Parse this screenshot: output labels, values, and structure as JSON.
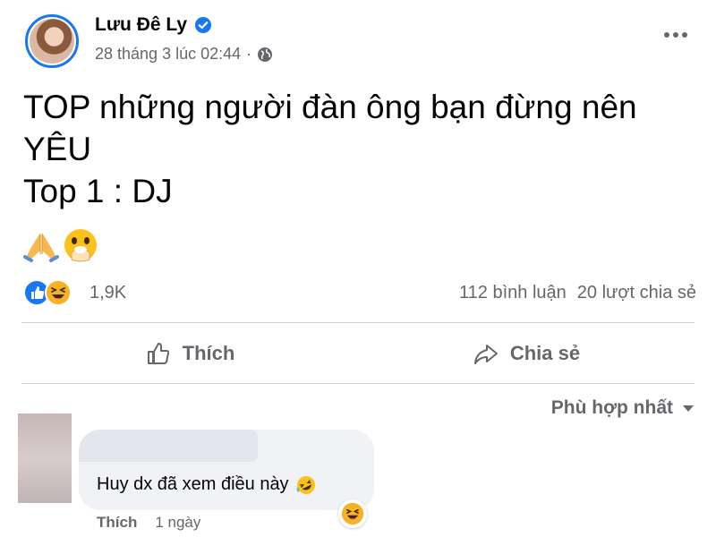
{
  "post": {
    "author": "Lưu Đê Ly",
    "timestamp": "28 tháng 3 lúc 02:44",
    "text_lines": [
      "TOP những người đàn ông bạn đừng nên",
      "YÊU",
      "Top 1 : DJ"
    ],
    "emojis": [
      "folded-hands-emoji",
      "face-with-hand-over-mouth-emoji"
    ]
  },
  "stats": {
    "reactions": [
      "like",
      "haha"
    ],
    "reaction_count": "1,9K",
    "comments": "112 bình luận",
    "shares": "20 lượt chia sẻ"
  },
  "actions": {
    "like_label": "Thích",
    "share_label": "Chia sẻ"
  },
  "comments_section": {
    "sort_label": "Phù hợp nhất",
    "comment": {
      "text": "Huy dx đã xem điều này",
      "like_label": "Thích",
      "time": "1 ngày"
    }
  },
  "colors": {
    "accent": "#1877f2",
    "secondary_text": "#65676b",
    "bubble": "#f0f2f5",
    "haha": "#f7b125"
  }
}
